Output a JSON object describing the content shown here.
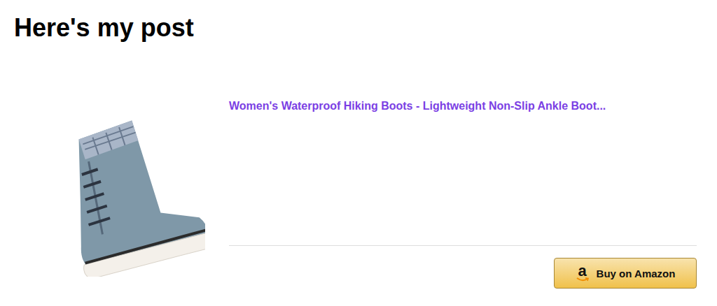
{
  "heading": "Here's my post",
  "product": {
    "title": "Women's Waterproof Hiking Boots - Lightweight Non-Slip Ankle Boot...",
    "button": {
      "logo": "a",
      "label": "Buy on Amazon"
    }
  }
}
